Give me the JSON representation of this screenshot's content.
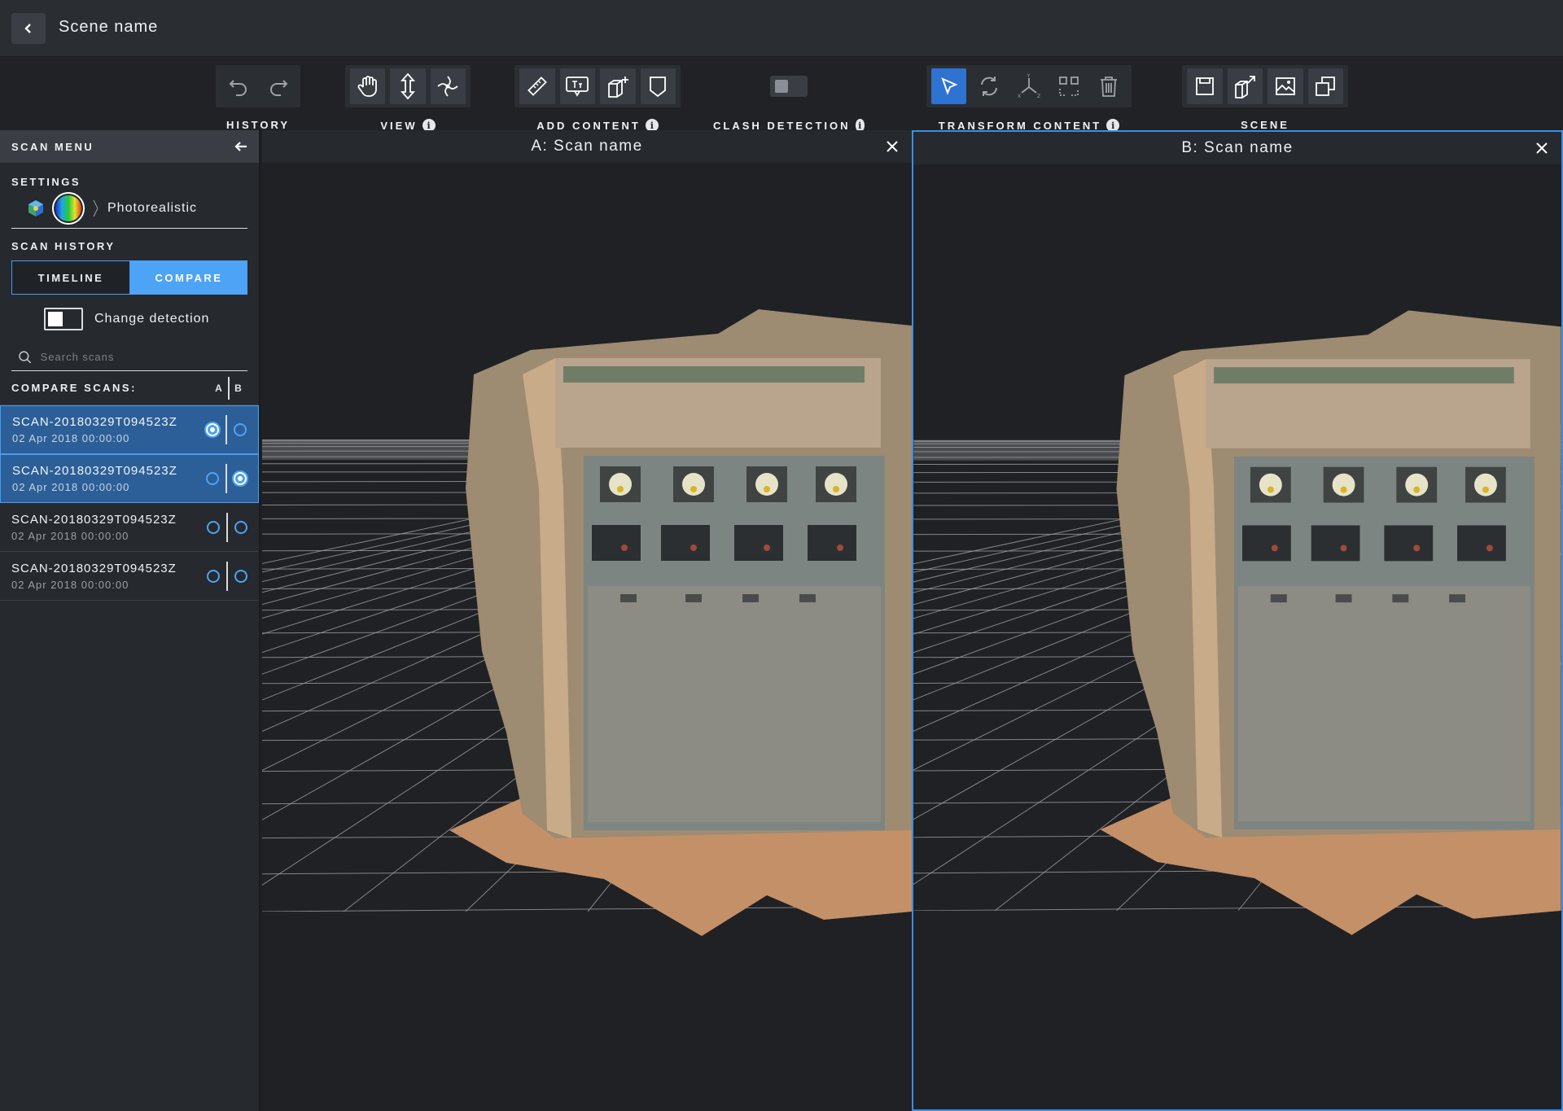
{
  "header": {
    "title": "Scene name"
  },
  "toolbar": {
    "groups": [
      {
        "label": "HISTORY",
        "icons": [
          "undo-icon",
          "redo-icon"
        ]
      },
      {
        "label": "VIEW",
        "icons": [
          "pan-hand-icon",
          "vertical-move-icon",
          "orbit-icon"
        ]
      },
      {
        "label": "ADD CONTENT",
        "icons": [
          "measure-ruler-icon",
          "text-annotation-icon",
          "add-object-icon",
          "tag-icon"
        ]
      },
      {
        "label": "CLASH DETECTION",
        "icons": [
          "toggle"
        ]
      },
      {
        "label": "TRANSFORM CONTENT",
        "icons": [
          "select-cursor-icon",
          "rotate-icon",
          "axes-icon",
          "bounding-box-icon",
          "trash-icon"
        ]
      },
      {
        "label": "SCENE",
        "icons": [
          "save-icon",
          "export-icon",
          "image-icon",
          "duplicate-icon"
        ]
      }
    ]
  },
  "sidebar": {
    "header": "SCAN MENU",
    "settings_title": "SETTINGS",
    "render_mode": "Photorealistic",
    "scan_history_title": "SCAN HISTORY",
    "tabs": [
      {
        "label": "TIMELINE",
        "active": false
      },
      {
        "label": "COMPARE",
        "active": true
      }
    ],
    "change_detection_label": "Change detection",
    "search_placeholder": "Search scans",
    "compare_title": "COMPARE SCANS:",
    "col_a": "A",
    "col_b": "B",
    "scans": [
      {
        "name": "SCAN-20180329T094523Z",
        "date": "02 Apr 2018 00:00:00",
        "a": true,
        "b": false
      },
      {
        "name": "SCAN-20180329T094523Z",
        "date": "02 Apr 2018 00:00:00",
        "a": false,
        "b": true
      },
      {
        "name": "SCAN-20180329T094523Z",
        "date": "02 Apr 2018 00:00:00",
        "a": false,
        "b": false
      },
      {
        "name": "SCAN-20180329T094523Z",
        "date": "02 Apr 2018 00:00:00",
        "a": false,
        "b": false
      }
    ]
  },
  "panes": {
    "a_title": "A: Scan name",
    "b_title": "B: Scan name"
  },
  "colors": {
    "accent": "#4da3f5",
    "active_tool": "#2e72d2",
    "pane_border": "#3d8ee6"
  }
}
